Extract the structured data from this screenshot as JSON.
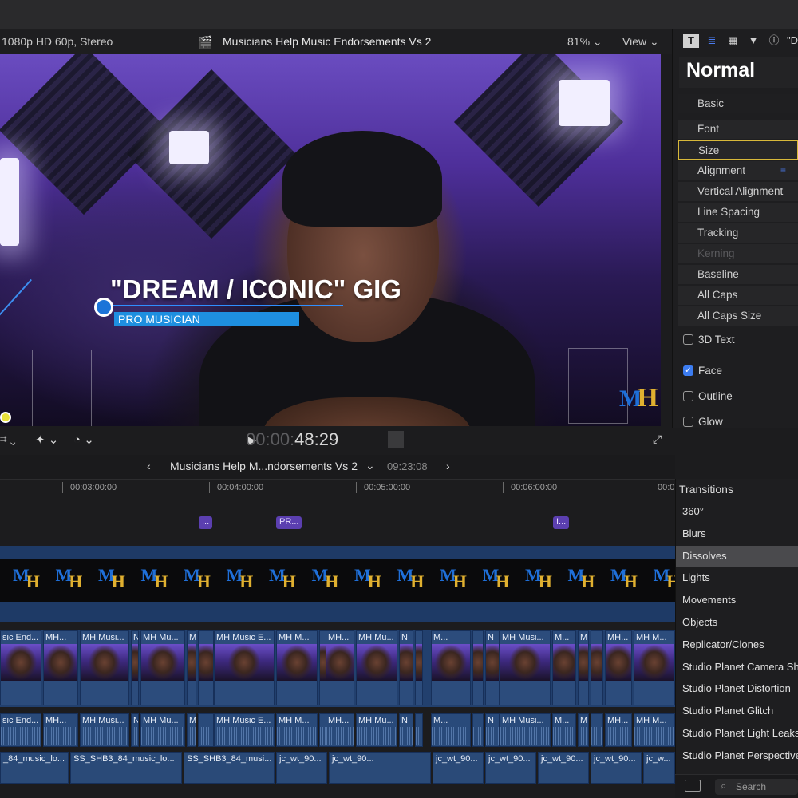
{
  "viewer": {
    "format": "1080p HD 60p, Stereo",
    "project_title": "Musicians Help Music Endorsements Vs 2",
    "zoom": "81%",
    "view_menu": "View",
    "timecode_dim": "00:00:",
    "timecode_lit": "48:29",
    "lower_third_title": "\"DREAM / ICONIC\" GIG",
    "lower_third_subtitle": "PRO MUSICIAN",
    "logo_m": "M",
    "logo_h": "H"
  },
  "inspector": {
    "tab_title_icon": "T",
    "tab_partial": "\"D",
    "preset": "Normal",
    "section": "Basic",
    "rows": [
      {
        "label": "Font",
        "disabled": false,
        "selected": false
      },
      {
        "label": "Size",
        "disabled": false,
        "selected": true
      },
      {
        "label": "Alignment",
        "disabled": false,
        "selected": false
      },
      {
        "label": "Vertical Alignment",
        "disabled": false,
        "selected": false
      },
      {
        "label": "Line Spacing",
        "disabled": false,
        "selected": false
      },
      {
        "label": "Tracking",
        "disabled": false,
        "selected": false
      },
      {
        "label": "Kerning",
        "disabled": true,
        "selected": false
      },
      {
        "label": "Baseline",
        "disabled": false,
        "selected": false
      },
      {
        "label": "All Caps",
        "disabled": false,
        "selected": false
      },
      {
        "label": "All Caps Size",
        "disabled": false,
        "selected": false
      }
    ],
    "checks": [
      {
        "label": "3D Text",
        "checked": false
      },
      {
        "label": "Face",
        "checked": true
      },
      {
        "label": "Outline",
        "checked": false
      },
      {
        "label": "Glow",
        "checked": false
      }
    ]
  },
  "timeline": {
    "project": "Musicians Help M...ndorsements Vs 2",
    "duration": "09:23:08",
    "ruler": [
      "00:03:00:00",
      "00:04:00:00",
      "00:05:00:00",
      "00:06:00:00",
      "00:0"
    ],
    "markers": [
      "...",
      "PR...",
      "I..."
    ],
    "video_clips": [
      "sic End...",
      "MH...",
      "MH Musi...",
      "N",
      "MH Mu...",
      "M",
      "MH Music E...",
      "MH M...",
      "MH...",
      "MH Mu...",
      "N",
      "M...",
      "N",
      "MH Musi...",
      "M...",
      "M",
      "MH...",
      "MH M..."
    ],
    "audio_clips": [
      "sic End...",
      "MH...",
      "MH Musi...",
      "N",
      "MH Mu...",
      "M",
      "MH Music E...",
      "MH M...",
      "MH...",
      "MH Mu...",
      "N",
      "M...",
      "N",
      "MH Musi...",
      "M...",
      "M",
      "MH...",
      "MH M..."
    ],
    "music_clips": [
      "_84_music_lo...",
      "SS_SHB3_84_music_lo...",
      "SS_SHB3_84_musi...",
      "jc_wt_90...",
      "jc_wt_90...",
      "jc_wt_90...",
      "jc_wt_90...",
      "jc_wt_90...",
      "jc_wt_90...",
      "jc_w..."
    ]
  },
  "transitions": {
    "title": "Transitions",
    "items": [
      "360°",
      "Blurs",
      "Dissolves",
      "Lights",
      "Movements",
      "Objects",
      "Replicator/Clones",
      "Studio Planet Camera Sh...",
      "Studio Planet Distortion",
      "Studio Planet Glitch",
      "Studio Planet Light Leaks",
      "Studio Planet Perspective"
    ],
    "selected": "Dissolves",
    "search_placeholder": "Search"
  },
  "colors": {
    "accent_blue": "#1e8fe0",
    "logo_blue": "#1f6fd8",
    "logo_gold": "#e0b030",
    "selection_yellow": "#d7b83a"
  }
}
